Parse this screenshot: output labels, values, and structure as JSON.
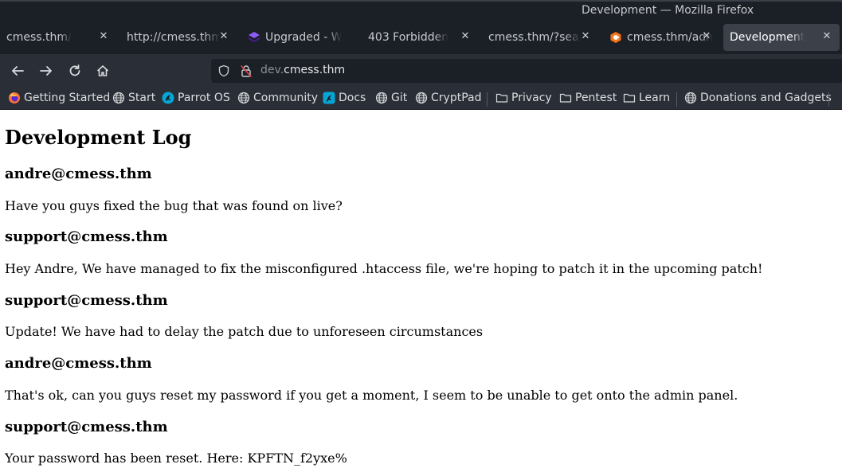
{
  "window": {
    "title": "Development — Mozilla Firefox"
  },
  "tabs": [
    {
      "label": "cmess.thm/",
      "active": false,
      "favicon": "none"
    },
    {
      "label": "http://cmess.thm/admin",
      "active": false,
      "favicon": "none"
    },
    {
      "label": "Upgraded - Wappalyzer",
      "active": false,
      "favicon": "wappalyzer-icon"
    },
    {
      "label": "403 Forbidden",
      "active": false,
      "favicon": "none"
    },
    {
      "label": "cmess.thm/?search",
      "active": false,
      "favicon": "none"
    },
    {
      "label": "cmess.thm/admin",
      "active": false,
      "favicon": "gila-cms-icon"
    },
    {
      "label": "Development",
      "active": true,
      "favicon": "none"
    }
  ],
  "navbar": {
    "url_prefix": "dev.",
    "url_host": "cmess.thm"
  },
  "bookmarks": [
    {
      "label": "Getting Started",
      "icon": "firefox-icon"
    },
    {
      "label": "Start",
      "icon": "globe-icon"
    },
    {
      "label": "Parrot OS",
      "icon": "parrot-icon"
    },
    {
      "label": "Community",
      "icon": "globe-icon"
    },
    {
      "label": "Docs",
      "icon": "parrot-docs-icon"
    },
    {
      "label": "Git",
      "icon": "globe-icon"
    },
    {
      "label": "CryptPad",
      "icon": "globe-icon"
    },
    {
      "label": "Privacy",
      "icon": "folder-icon"
    },
    {
      "label": "Pentest",
      "icon": "folder-icon"
    },
    {
      "label": "Learn",
      "icon": "folder-icon"
    },
    {
      "label": "Donations and Gadgets",
      "icon": "globe-icon"
    }
  ],
  "page": {
    "heading": "Development Log",
    "entries": [
      {
        "author": "andre@cmess.thm",
        "message": "Have you guys fixed the bug that was found on live?"
      },
      {
        "author": "support@cmess.thm",
        "message": "Hey Andre, We have managed to fix the misconfigured .htaccess file, we're hoping to patch it in the upcoming patch!"
      },
      {
        "author": "support@cmess.thm",
        "message": "Update! We have had to delay the patch due to unforeseen circumstances"
      },
      {
        "author": "andre@cmess.thm",
        "message": "That's ok, can you guys reset my password if you get a moment, I seem to be unable to get onto the admin panel."
      },
      {
        "author": "support@cmess.thm",
        "message": "Your password has been reset. Here: KPFTN_f2yxe%"
      }
    ]
  },
  "colors": {
    "chrome_dark": "#1b1f26",
    "toolbar": "#2a2e36",
    "active_tab": "#3b4049",
    "page_bg": "#ffffff"
  }
}
